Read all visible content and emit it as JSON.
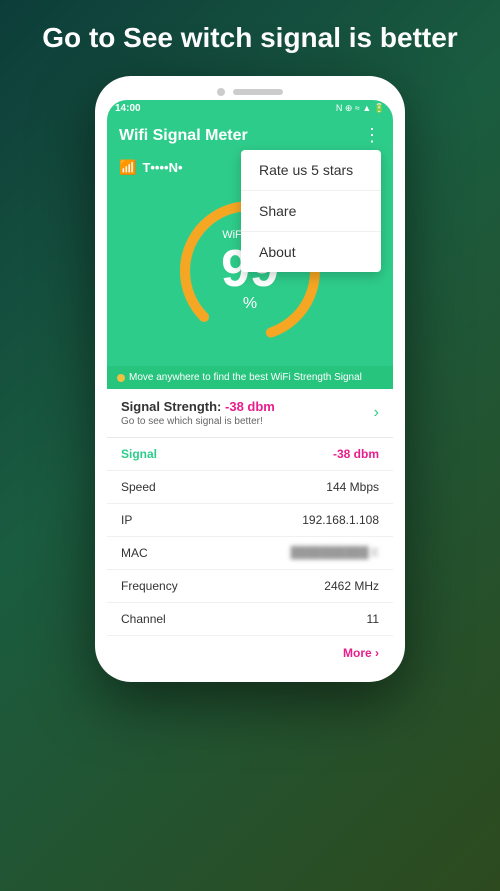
{
  "page": {
    "title": "Go to See witch signal is better",
    "background_hint": "dark teal gradient"
  },
  "phone": {
    "status_bar": {
      "time": "14:00",
      "icons_left": "◼ ◼ △ ▲ ☆ ⓟ",
      "icons_right": "N ⊕ ≈ ▲ ▲ 🔋"
    },
    "app_header": {
      "title": "Wifi Signal Meter",
      "menu_icon": "⋮"
    },
    "dropdown": {
      "items": [
        {
          "label": "Rate us 5 stars"
        },
        {
          "label": "Share"
        },
        {
          "label": "About"
        }
      ]
    },
    "wifi_bar": {
      "icon": "📶",
      "name": "T••••N•"
    },
    "signal_gauge": {
      "label": "WiFi Signal",
      "value": "99",
      "percent_symbol": "%"
    },
    "move_hint": {
      "text": "Move anywhere to find the best WiFi Strength Signal"
    },
    "signal_strength_card": {
      "title": "Signal Strength:",
      "value": "-38 dbm",
      "subtitle": "Go to see which signal is better!"
    },
    "data_rows": [
      {
        "label": "Signal",
        "value": "-38 dbm",
        "highlight": true
      },
      {
        "label": "Speed",
        "value": "144 Mbps",
        "highlight": false
      },
      {
        "label": "IP",
        "value": "192.168.1.108",
        "highlight": false
      },
      {
        "label": "MAC",
        "value": "••••••••••••E",
        "highlight": false,
        "blur": true
      },
      {
        "label": "Frequency",
        "value": "2462 MHz",
        "highlight": false
      },
      {
        "label": "Channel",
        "value": "11",
        "highlight": false
      }
    ],
    "more_link": "More ›"
  }
}
